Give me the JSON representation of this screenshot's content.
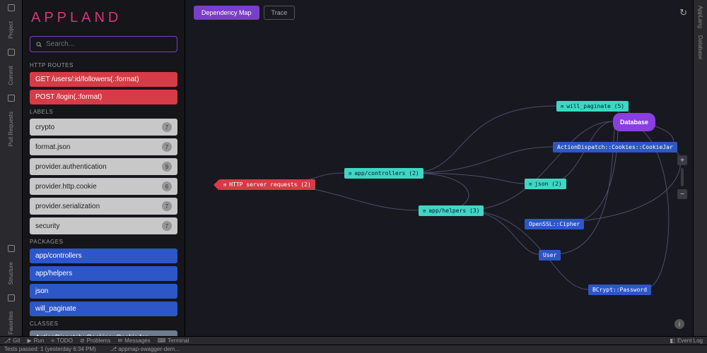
{
  "logo": "APPLAND",
  "search": {
    "placeholder": "Search..."
  },
  "rails": {
    "left": [
      "Project",
      "Commit",
      "Pull Requests",
      "Structure",
      "Favorites"
    ],
    "right": [
      "AppLang",
      "Database"
    ]
  },
  "sections": {
    "routes": {
      "title": "HTTP ROUTES",
      "items": [
        "GET /users/:id/followers(.:format)",
        "POST /login(.:format)"
      ]
    },
    "labels": {
      "title": "LABELS",
      "items": [
        {
          "name": "crypto",
          "count": 7
        },
        {
          "name": "format.json",
          "count": 7
        },
        {
          "name": "provider.authentication",
          "count": 9
        },
        {
          "name": "provider.http.cookie",
          "count": 6
        },
        {
          "name": "provider.serialization",
          "count": 7
        },
        {
          "name": "security",
          "count": 7
        }
      ]
    },
    "packages": {
      "title": "PACKAGES",
      "items": [
        "app/controllers",
        "app/helpers",
        "json",
        "will_paginate"
      ]
    },
    "classes": {
      "title": "CLASSES",
      "items": [
        "ActionDispatch::Cookies::CookieJar"
      ]
    }
  },
  "topbar": {
    "primary": "Dependency Map",
    "ghost": "Trace"
  },
  "nodes": {
    "http": {
      "label": "HTTP server requests (2)"
    },
    "controllers": {
      "label": "app/controllers (2)"
    },
    "helpers": {
      "label": "app/helpers (3)"
    },
    "paginate": {
      "label": "will_paginate (5)"
    },
    "cookies": {
      "label": "ActionDispatch::Cookies::CookieJar"
    },
    "json": {
      "label": "json (2)"
    },
    "openssl": {
      "label": "OpenSSL::Cipher"
    },
    "user": {
      "label": "User"
    },
    "bcrypt": {
      "label": "BCrypt::Password"
    },
    "database": {
      "label": "Database"
    }
  },
  "status": {
    "git": "Git",
    "run": "Run",
    "todo": "TODO",
    "problems": "Problems",
    "messages": "Messages",
    "terminal": "Terminal",
    "eventlog": "Event Log",
    "branch": "appmap-swagger-dem..."
  },
  "run": {
    "tests": "Tests passed: 1 (yesterday 6:34 PM)"
  }
}
